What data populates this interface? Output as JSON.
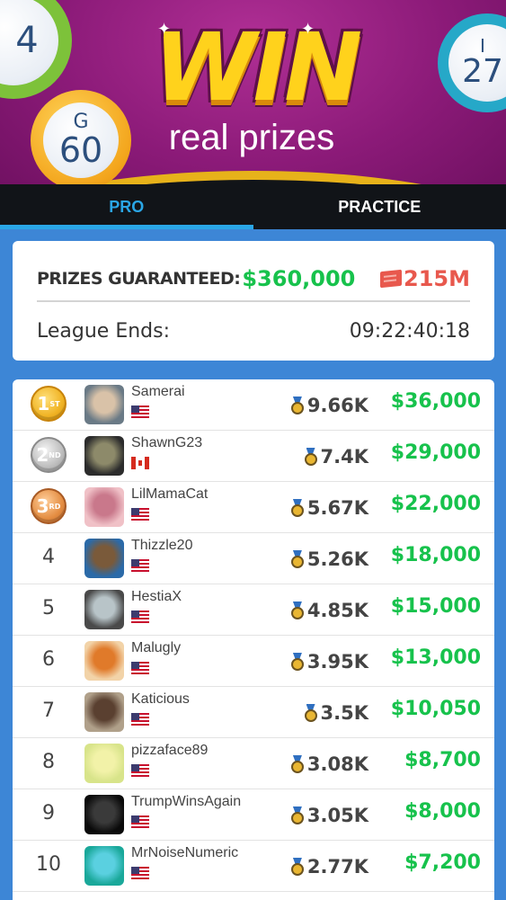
{
  "header": {
    "win_text": "WIN",
    "subtitle": "real prizes",
    "balls": {
      "left": {
        "number": "4"
      },
      "gold": {
        "letter": "G",
        "number": "60"
      },
      "right": {
        "letter": "I",
        "number": "27"
      }
    }
  },
  "tabs": [
    {
      "label": "PRO",
      "active": true
    },
    {
      "label": "PRACTICE",
      "active": false
    }
  ],
  "info": {
    "prize_label": "PRIZES GUARANTEED:",
    "prize_amount": "$360,000",
    "tickets": "215M",
    "league_label": "League Ends:",
    "league_time": "09:22:40:18"
  },
  "leaderboard": [
    {
      "rank": "1",
      "rank_suffix": "ST",
      "medal": "gold",
      "name": "Samerai",
      "flag": "us",
      "score": "9.66K",
      "prize": "$36,000"
    },
    {
      "rank": "2",
      "rank_suffix": "ND",
      "medal": "silver",
      "name": "ShawnG23",
      "flag": "ca",
      "score": "7.4K",
      "prize": "$29,000"
    },
    {
      "rank": "3",
      "rank_suffix": "RD",
      "medal": "bronze",
      "name": "LilMamaCat",
      "flag": "us",
      "score": "5.67K",
      "prize": "$22,000"
    },
    {
      "rank": "4",
      "medal": "",
      "name": "Thizzle20",
      "flag": "us",
      "score": "5.26K",
      "prize": "$18,000"
    },
    {
      "rank": "5",
      "medal": "",
      "name": "HestiaX",
      "flag": "us",
      "score": "4.85K",
      "prize": "$15,000"
    },
    {
      "rank": "6",
      "medal": "",
      "name": "Malugly",
      "flag": "us",
      "score": "3.95K",
      "prize": "$13,000"
    },
    {
      "rank": "7",
      "medal": "",
      "name": "Katicious",
      "flag": "us",
      "score": "3.5K",
      "prize": "$10,050"
    },
    {
      "rank": "8",
      "medal": "",
      "name": "pizzaface89",
      "flag": "us",
      "score": "3.08K",
      "prize": "$8,700"
    },
    {
      "rank": "9",
      "medal": "",
      "name": "TrumpWinsAgain",
      "flag": "us",
      "score": "3.05K",
      "prize": "$8,000"
    },
    {
      "rank": "10",
      "medal": "",
      "name": "MrNoiseNumeric",
      "flag": "us",
      "score": "2.77K",
      "prize": "$7,200"
    }
  ],
  "colors": {
    "header_bg": "#8b1a78",
    "gold": "#ffd21c",
    "active_tab": "#2aa6e6",
    "prize_green": "#17c24c",
    "ticket_red": "#e8584d",
    "page_bg": "#3d86d6"
  },
  "icons": {
    "ticket": "ticket-icon",
    "score": "medal-score-icon"
  }
}
